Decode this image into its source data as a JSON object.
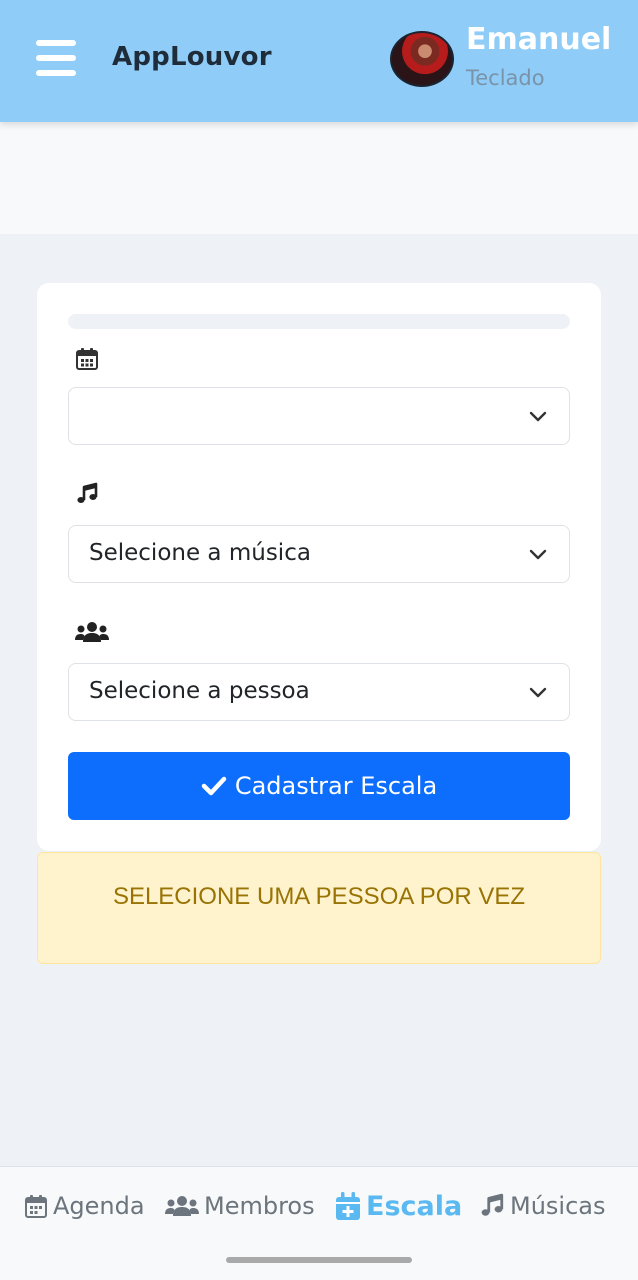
{
  "header": {
    "app_title": "AppLouvor",
    "user_name": "Emanuel",
    "user_role": "Teclado"
  },
  "form": {
    "date_select_value": "",
    "music_select_value": "Selecione a música",
    "person_select_value": "Selecione a pessoa",
    "submit_label": "Cadastrar Escala"
  },
  "alert": {
    "message": "SELECIONE UMA PESSOA POR VEZ"
  },
  "bottom_nav": {
    "items": [
      {
        "label": "Agenda",
        "icon": "calendar-icon",
        "active": false
      },
      {
        "label": "Membros",
        "icon": "users-icon",
        "active": false
      },
      {
        "label": "Escala",
        "icon": "calendar-plus-icon",
        "active": true
      },
      {
        "label": "Músicas",
        "icon": "music-icon",
        "active": false
      }
    ]
  },
  "colors": {
    "header_bg": "#8fcdf8",
    "primary_button": "#0d6efd",
    "active_nav": "#5ab9f0",
    "alert_bg": "#fff3cd",
    "alert_text": "#997404"
  }
}
